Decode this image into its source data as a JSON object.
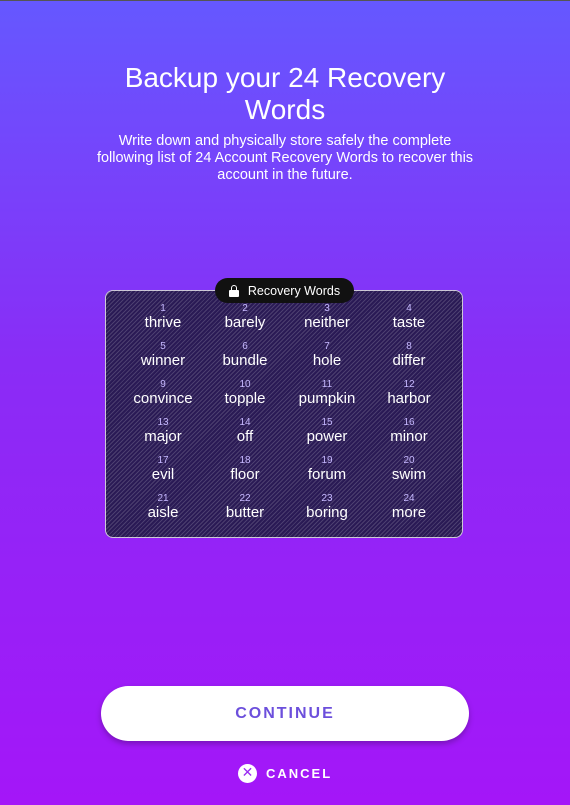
{
  "header": {
    "title_line1": "Backup your 24 Recovery",
    "title_line2": "Words",
    "description": "Write down and physically store safely the complete following list of 24 Account Recovery Words to recover this account in the future."
  },
  "recovery": {
    "label": "Recovery Words",
    "label_icon": "lock-icon",
    "words": [
      {
        "num": "1",
        "word": "thrive"
      },
      {
        "num": "2",
        "word": "barely"
      },
      {
        "num": "3",
        "word": "neither"
      },
      {
        "num": "4",
        "word": "taste"
      },
      {
        "num": "5",
        "word": "winner"
      },
      {
        "num": "6",
        "word": "bundle"
      },
      {
        "num": "7",
        "word": "hole"
      },
      {
        "num": "8",
        "word": "differ"
      },
      {
        "num": "9",
        "word": "convince"
      },
      {
        "num": "10",
        "word": "topple"
      },
      {
        "num": "11",
        "word": "pumpkin"
      },
      {
        "num": "12",
        "word": "harbor"
      },
      {
        "num": "13",
        "word": "major"
      },
      {
        "num": "14",
        "word": "off"
      },
      {
        "num": "15",
        "word": "power"
      },
      {
        "num": "16",
        "word": "minor"
      },
      {
        "num": "17",
        "word": "evil"
      },
      {
        "num": "18",
        "word": "floor"
      },
      {
        "num": "19",
        "word": "forum"
      },
      {
        "num": "20",
        "word": "swim"
      },
      {
        "num": "21",
        "word": "aisle"
      },
      {
        "num": "22",
        "word": "butter"
      },
      {
        "num": "23",
        "word": "boring"
      },
      {
        "num": "24",
        "word": "more"
      }
    ]
  },
  "actions": {
    "continue_label": "CONTINUE",
    "cancel_label": "CANCEL",
    "cancel_icon": "close-circle-icon"
  },
  "colors": {
    "gradient_top": "#6558ff",
    "gradient_bottom": "#a416f8",
    "accent": "#6c4fdc"
  }
}
